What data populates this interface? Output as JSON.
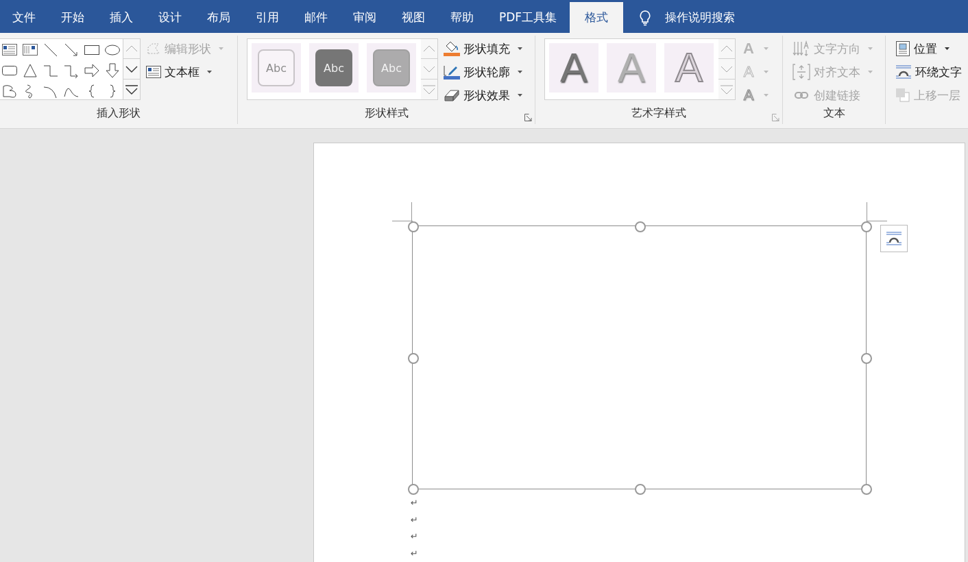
{
  "tabs": [
    {
      "label": "文件",
      "selected": false
    },
    {
      "label": "开始",
      "selected": false
    },
    {
      "label": "插入",
      "selected": false
    },
    {
      "label": "设计",
      "selected": false
    },
    {
      "label": "布局",
      "selected": false
    },
    {
      "label": "引用",
      "selected": false
    },
    {
      "label": "邮件",
      "selected": false
    },
    {
      "label": "审阅",
      "selected": false
    },
    {
      "label": "视图",
      "selected": false
    },
    {
      "label": "帮助",
      "selected": false
    },
    {
      "label": "PDF工具集",
      "selected": false
    },
    {
      "label": "格式",
      "selected": true
    }
  ],
  "tell_me": {
    "label": "操作说明搜索"
  },
  "insert_shapes": {
    "label": "插入形状",
    "commands": [
      {
        "label": "编辑形状",
        "kind": "edit",
        "disabled": true,
        "dropdown": true
      },
      {
        "label": "文本框",
        "kind": "textbox",
        "disabled": false,
        "dropdown": true
      }
    ]
  },
  "shape_styles": {
    "label": "形状样式",
    "styles": [
      {
        "label": "Abc",
        "kind": "outline"
      },
      {
        "label": "Abc",
        "kind": "dark"
      },
      {
        "label": "Abc",
        "kind": "medium"
      }
    ],
    "commands": [
      {
        "label": "形状填充",
        "kind": "fill",
        "disabled": false
      },
      {
        "label": "形状轮廓",
        "kind": "outline",
        "disabled": false
      },
      {
        "label": "形状效果",
        "kind": "effects",
        "disabled": false
      }
    ]
  },
  "wordart_styles": {
    "label": "艺术字样式",
    "styles": [
      {
        "label": "A",
        "kind": "dark"
      },
      {
        "label": "A",
        "kind": "light"
      },
      {
        "label": "A",
        "kind": "outline"
      }
    ],
    "commands": [
      {
        "label": "A",
        "kind": "fill",
        "disabled": true
      },
      {
        "label": "A",
        "kind": "outline",
        "disabled": true
      },
      {
        "label": "A",
        "kind": "effects",
        "disabled": true
      }
    ]
  },
  "text": {
    "label": "文本",
    "commands": [
      {
        "label": "文字方向",
        "kind": "direction",
        "disabled": true,
        "dropdown": true
      },
      {
        "label": "对齐文本",
        "kind": "align",
        "disabled": true,
        "dropdown": true
      },
      {
        "label": "创建链接",
        "kind": "link",
        "disabled": true,
        "dropdown": false
      }
    ]
  },
  "arrange": {
    "commands": [
      {
        "label": "位置",
        "kind": "position",
        "disabled": false,
        "dropdown": true
      },
      {
        "label": "环绕文字",
        "kind": "wrap",
        "disabled": false,
        "dropdown": false
      },
      {
        "label": "上移一层",
        "kind": "forward",
        "disabled": true,
        "dropdown": false
      }
    ]
  },
  "document": {
    "text_box": {
      "selected": true
    },
    "paragraph_marks": [
      "↵",
      "↵",
      "↵",
      "↵"
    ]
  }
}
